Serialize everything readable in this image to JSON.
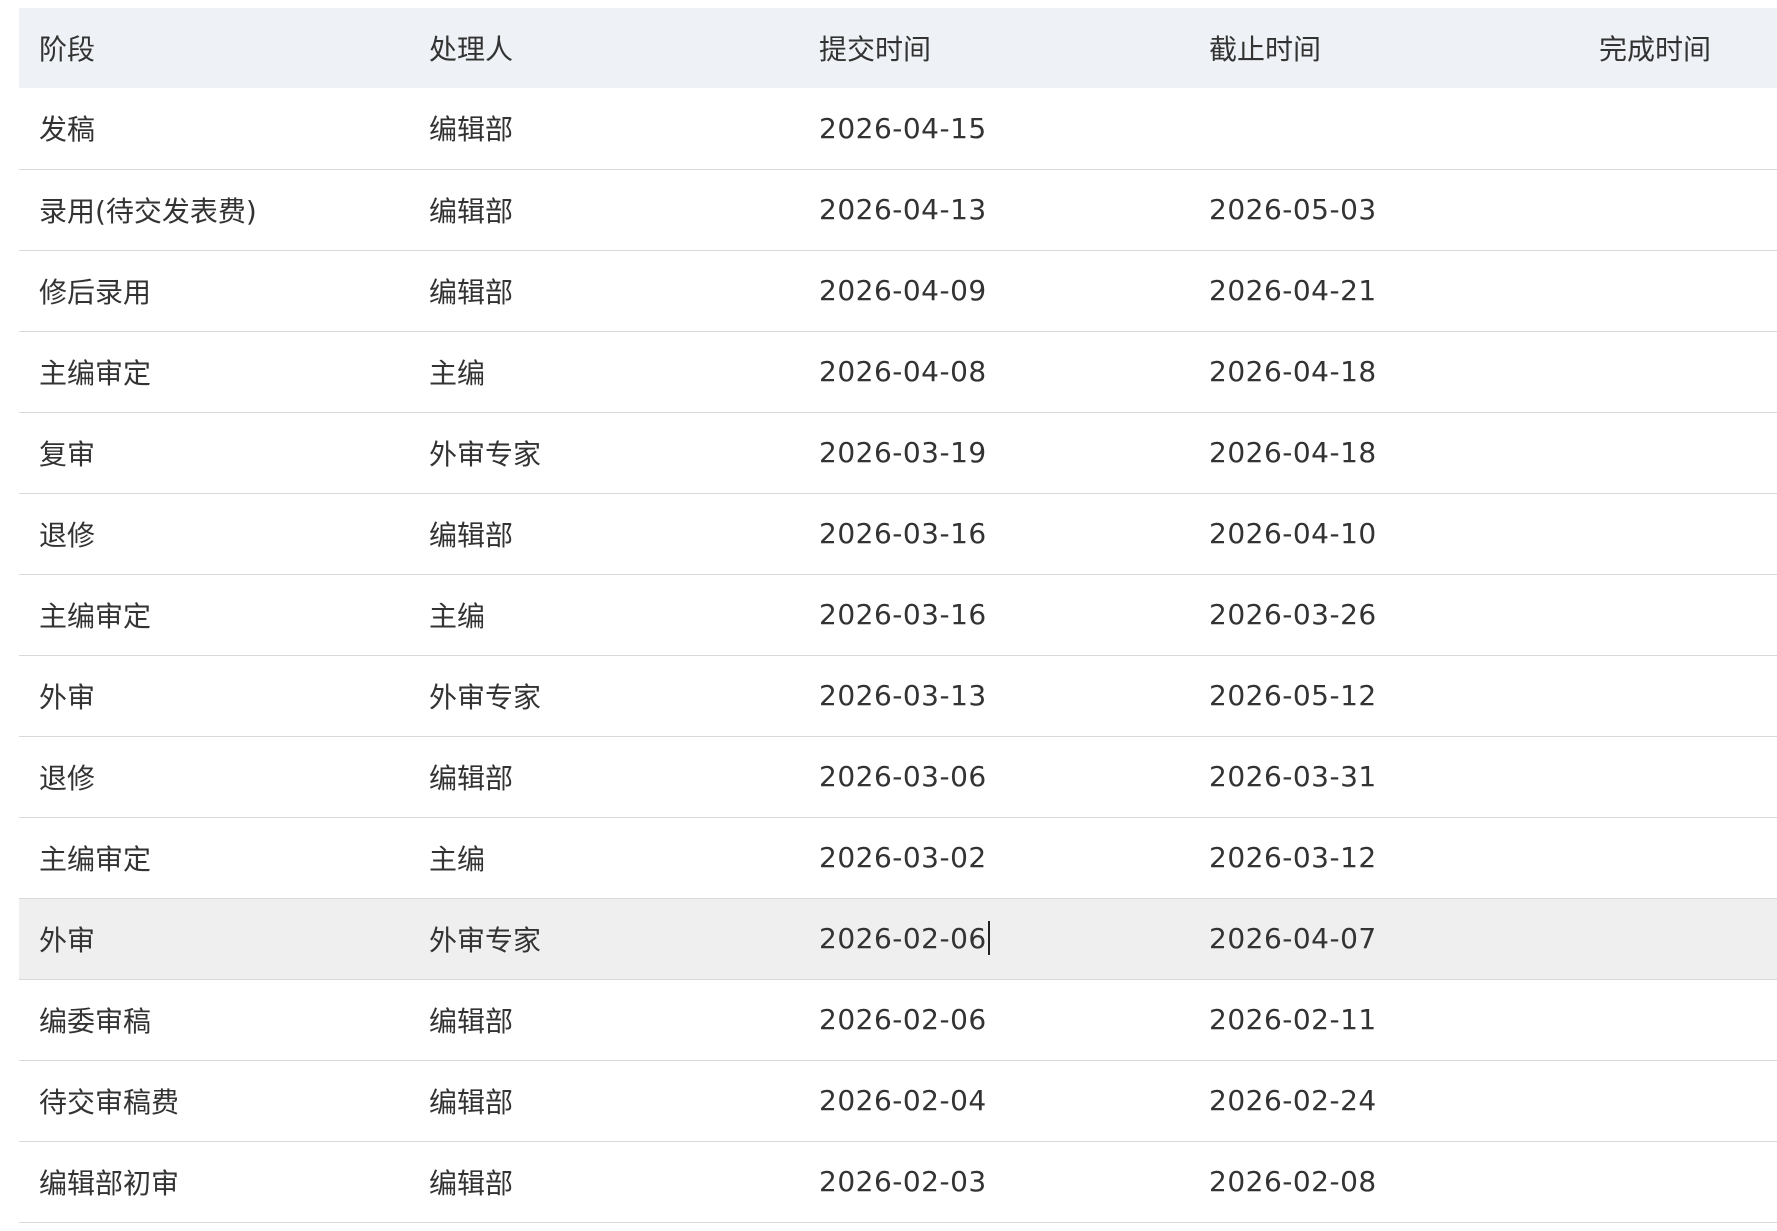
{
  "table": {
    "headers": [
      "阶段",
      "处理人",
      "提交时间",
      "截止时间",
      "完成时间"
    ],
    "rows": [
      {
        "stage": "发稿",
        "handler": "编辑部",
        "submitted": "2026-04-15",
        "deadline": "",
        "completed": ""
      },
      {
        "stage": "录用(待交发表费)",
        "handler": "编辑部",
        "submitted": "2026-04-13",
        "deadline": "2026-05-03",
        "completed": ""
      },
      {
        "stage": "修后录用",
        "handler": "编辑部",
        "submitted": "2026-04-09",
        "deadline": "2026-04-21",
        "completed": ""
      },
      {
        "stage": "主编审定",
        "handler": "主编",
        "submitted": "2026-04-08",
        "deadline": "2026-04-18",
        "completed": ""
      },
      {
        "stage": "复审",
        "handler": "外审专家",
        "submitted": "2026-03-19",
        "deadline": "2026-04-18",
        "completed": ""
      },
      {
        "stage": "退修",
        "handler": "编辑部",
        "submitted": "2026-03-16",
        "deadline": "2026-04-10",
        "completed": ""
      },
      {
        "stage": "主编审定",
        "handler": "主编",
        "submitted": "2026-03-16",
        "deadline": "2026-03-26",
        "completed": ""
      },
      {
        "stage": "外审",
        "handler": "外审专家",
        "submitted": "2026-03-13",
        "deadline": "2026-05-12",
        "completed": ""
      },
      {
        "stage": "退修",
        "handler": "编辑部",
        "submitted": "2026-03-06",
        "deadline": "2026-03-31",
        "completed": ""
      },
      {
        "stage": "主编审定",
        "handler": "主编",
        "submitted": "2026-03-02",
        "deadline": "2026-03-12",
        "completed": ""
      },
      {
        "stage": "外审",
        "handler": "外审专家",
        "submitted": "2026-02-06",
        "deadline": "2026-04-07",
        "completed": ""
      },
      {
        "stage": "编委审稿",
        "handler": "编辑部",
        "submitted": "2026-02-06",
        "deadline": "2026-02-11",
        "completed": ""
      },
      {
        "stage": "待交审稿费",
        "handler": "编辑部",
        "submitted": "2026-02-04",
        "deadline": "2026-02-24",
        "completed": ""
      },
      {
        "stage": "编辑部初审",
        "handler": "编辑部",
        "submitted": "2026-02-03",
        "deadline": "2026-02-08",
        "completed": ""
      }
    ]
  },
  "colors": {
    "header_bg": "#eef1f5",
    "hover_row_bg": "#efefef",
    "row_border": "#d9d9d9",
    "text": "#333333"
  }
}
